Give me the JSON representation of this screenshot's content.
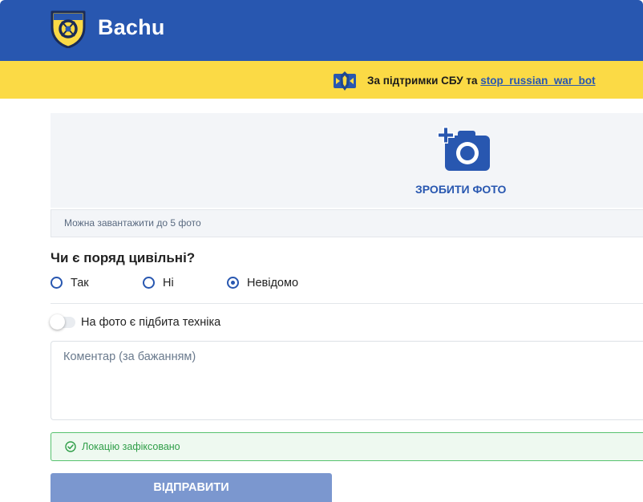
{
  "header": {
    "brand": "Bachu",
    "logo_icon": "bachu-logo-icon"
  },
  "banner": {
    "text": "За підтримки СБУ та",
    "link": "stop_russian_war_bot",
    "emblem_icon": "sbu-emblem-icon"
  },
  "upload": {
    "button_label": "ЗРОБИТИ ФОТО",
    "icon": "camera-plus-icon",
    "note": "Можна завантажити до 5 фото"
  },
  "question": {
    "title": "Чи є поряд цивільні?",
    "options": [
      {
        "label": "Так",
        "selected": false
      },
      {
        "label": "Ні",
        "selected": false
      },
      {
        "label": "Невідомо",
        "selected": true
      }
    ]
  },
  "toggle": {
    "label": "На фото є підбита техніка",
    "checked": false
  },
  "comment": {
    "placeholder": "Коментар (за бажанням)",
    "value": ""
  },
  "location": {
    "text": "Локацію зафіксовано",
    "icon": "check-circle-icon"
  },
  "submit": {
    "label": "ВІДПРАВИТИ"
  },
  "colors": {
    "header": "#2857b0",
    "banner": "#fbda45",
    "accent": "#2857b0",
    "success": "#2f9e48",
    "submit": "#7b97cf"
  }
}
